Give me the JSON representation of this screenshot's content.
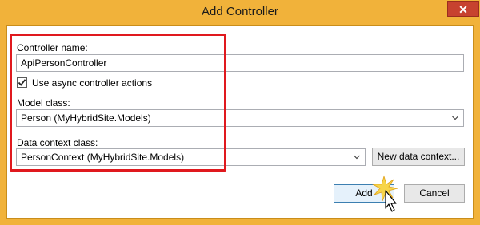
{
  "window": {
    "title": "Add Controller",
    "close_glyph": "✕"
  },
  "form": {
    "controller_name_label": "Controller name:",
    "controller_name_value": "ApiPersonController",
    "async_checkbox_label": "Use async controller actions",
    "async_checked": true,
    "model_class_label": "Model class:",
    "model_class_value": "Person (MyHybridSite.Models)",
    "data_context_label": "Data context class:",
    "data_context_value": "PersonContext (MyHybridSite.Models)",
    "new_data_context_button": "New data context..."
  },
  "buttons": {
    "add": "Add",
    "cancel": "Cancel"
  },
  "colors": {
    "highlight": "#e0191e",
    "frame": "#f1b23a",
    "close": "#c7422f"
  }
}
